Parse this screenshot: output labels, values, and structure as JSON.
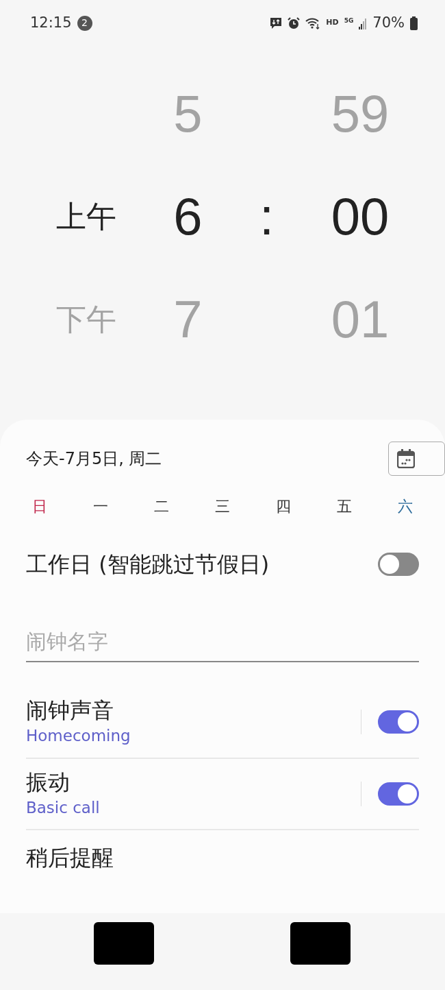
{
  "status_bar": {
    "time": "12:15",
    "notification_count": "2",
    "hd": "HD",
    "network": "5G",
    "battery": "70%"
  },
  "time_picker": {
    "ampm": [
      {
        "label": "上午",
        "selected": true
      },
      {
        "label": "下午",
        "selected": false
      }
    ],
    "hours": [
      {
        "label": "5",
        "selected": false
      },
      {
        "label": "6",
        "selected": true
      },
      {
        "label": "7",
        "selected": false
      }
    ],
    "separator": ":",
    "minutes": [
      {
        "label": "59",
        "selected": false
      },
      {
        "label": "00",
        "selected": true
      },
      {
        "label": "01",
        "selected": false
      }
    ]
  },
  "date": {
    "label": "今天-7月5日, 周二"
  },
  "days": [
    {
      "label": "日",
      "selected": false,
      "color": "#c0264b"
    },
    {
      "label": "一",
      "selected": false,
      "color": "#333333"
    },
    {
      "label": "二",
      "selected": false,
      "color": "#333333"
    },
    {
      "label": "三",
      "selected": false,
      "color": "#333333"
    },
    {
      "label": "四",
      "selected": false,
      "color": "#333333"
    },
    {
      "label": "五",
      "selected": false,
      "color": "#333333"
    },
    {
      "label": "六",
      "selected": false,
      "color": "#2b6a9a"
    }
  ],
  "workday": {
    "label": "工作日 (智能跳过节假日)",
    "on": false
  },
  "alarm_name": {
    "placeholder": "闹钟名字"
  },
  "settings": [
    {
      "title": "闹钟声音",
      "value": "Homecoming",
      "on": true
    },
    {
      "title": "振动",
      "value": "Basic call",
      "on": true
    },
    {
      "title": "稍后提醒"
    }
  ]
}
